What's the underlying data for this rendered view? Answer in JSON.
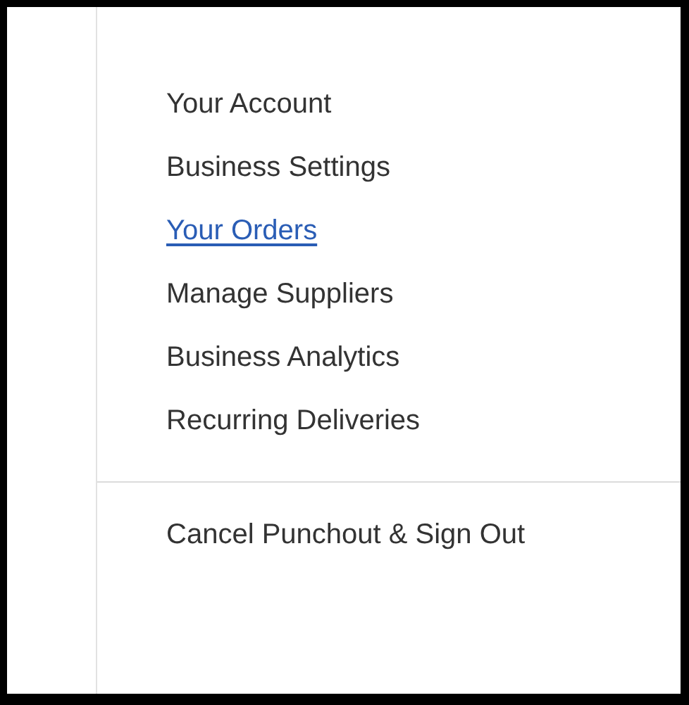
{
  "menu": {
    "items": [
      {
        "label": "Your Account",
        "selected": false
      },
      {
        "label": "Business Settings",
        "selected": false
      },
      {
        "label": "Your Orders",
        "selected": true
      },
      {
        "label": "Manage Suppliers",
        "selected": false
      },
      {
        "label": "Business Analytics",
        "selected": false
      },
      {
        "label": "Recurring Deliveries",
        "selected": false
      }
    ],
    "footer_item": {
      "label": "Cancel Punchout & Sign Out",
      "selected": false
    }
  }
}
